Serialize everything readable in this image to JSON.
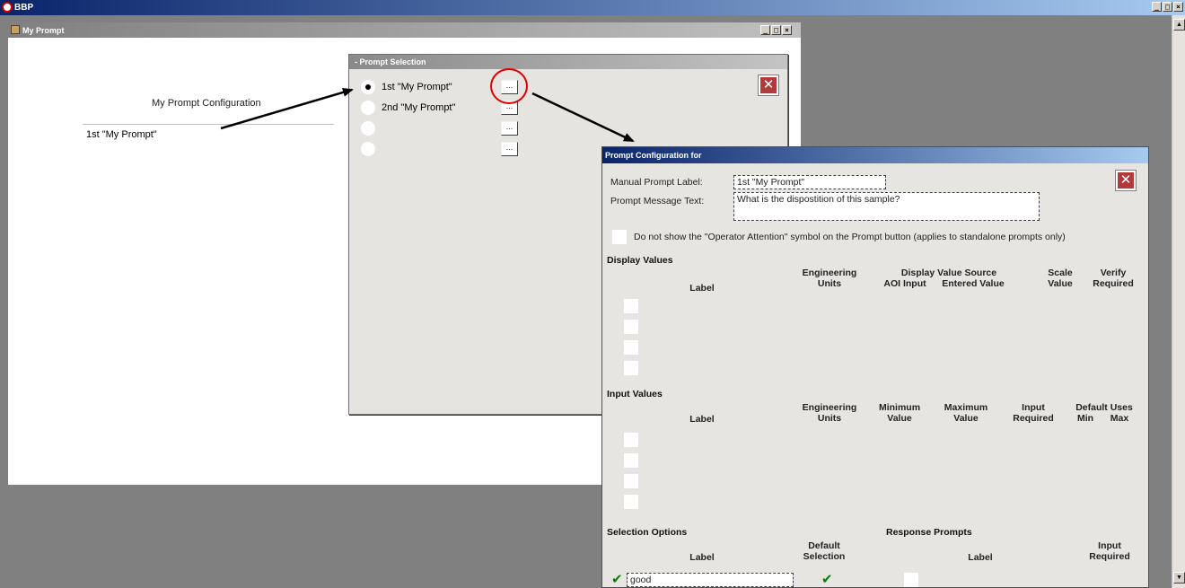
{
  "app": {
    "title": "BBP",
    "win_buttons": [
      "_",
      "□",
      "×"
    ]
  },
  "my_prompt_window": {
    "title": "My Prompt",
    "win_buttons": [
      "_",
      "□",
      "×"
    ],
    "config_label": "My Prompt Configuration",
    "field_value": "1st \"My Prompt\""
  },
  "prompt_selection": {
    "title": "- Prompt Selection",
    "items": [
      {
        "label": "1st \"My Prompt\"",
        "selected": true
      },
      {
        "label": "2nd \"My Prompt\"",
        "selected": false
      },
      {
        "label": "",
        "selected": false
      },
      {
        "label": "",
        "selected": false
      }
    ],
    "ellipsis": "...",
    "close_glyph": "✕"
  },
  "prompt_config": {
    "title": "Prompt Configuration for",
    "manual_prompt_label": "Manual Prompt Label:",
    "manual_prompt_value": "1st \"My Prompt\"",
    "prompt_message_label": "Prompt Message Text:",
    "prompt_message_value": "What is the dispostition of this sample?",
    "operator_attention_text": "Do not show the \"Operator Attention\" symbol on the Prompt button (applies to standalone prompts only)",
    "close_glyph": "✕",
    "display_values": {
      "title": "Display Values",
      "label": "Label",
      "eng_units": "Engineering\nUnits",
      "source": "Display Value Source",
      "aoi_input": "AOI Input",
      "entered_value": "Entered Value",
      "scale_value": "Scale\nValue",
      "verify_required": "Verify\nRequired"
    },
    "input_values": {
      "title": "Input Values",
      "label": "Label",
      "eng_units": "Engineering\nUnits",
      "min_value": "Minimum\nValue",
      "max_value": "Maximum\nValue",
      "input_required": "Input\nRequired",
      "default_uses": "Default Uses",
      "min": "Min",
      "max": "Max"
    },
    "selection_options": {
      "title": "Selection Options",
      "label": "Label",
      "default_selection": "Default\nSelection",
      "rows": [
        {
          "value": "good",
          "checked": true,
          "default": true
        }
      ],
      "check_glyph": "✔"
    },
    "response_prompts": {
      "title": "Response Prompts",
      "label": "Label",
      "input_required": "Input\nRequired"
    }
  },
  "colors": {
    "title_blue": "#0a246a",
    "annotation_red": "#e00000",
    "check_green": "#0a7a0a",
    "close_red": "#b23a3a"
  }
}
